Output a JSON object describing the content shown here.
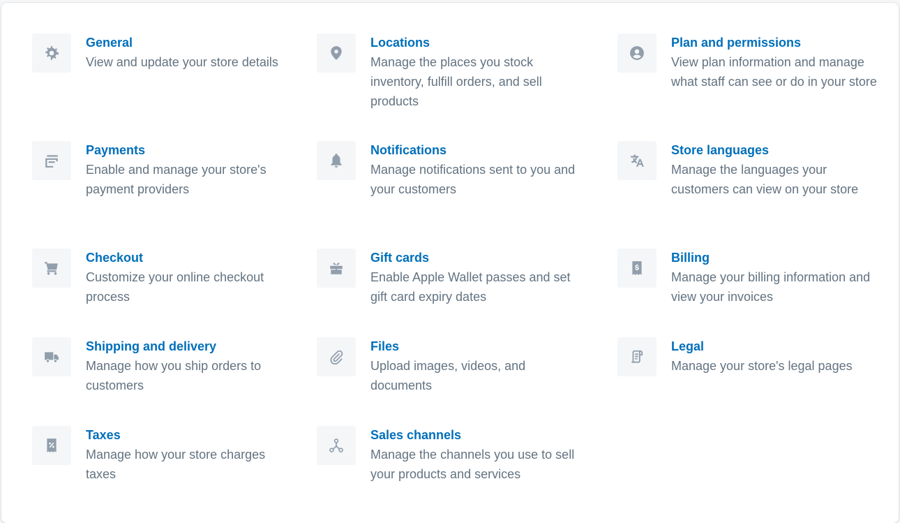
{
  "settings": {
    "items": [
      {
        "title": "General",
        "desc": "View and update your store details",
        "icon": "gear-icon"
      },
      {
        "title": "Locations",
        "desc": "Manage the places you stock inventory, fulfill orders, and sell products",
        "icon": "location-pin-icon"
      },
      {
        "title": "Plan and permissions",
        "desc": "View plan information and manage what staff can see or do in your store",
        "icon": "user-circle-icon"
      },
      {
        "title": "Payments",
        "desc": "Enable and manage your store's payment providers",
        "icon": "credit-card-icon"
      },
      {
        "title": "Notifications",
        "desc": "Manage notifications sent to you and your customers",
        "icon": "bell-icon"
      },
      {
        "title": "Store languages",
        "desc": "Manage the languages your customers can view on your store",
        "icon": "translate-icon"
      },
      {
        "title": "Checkout",
        "desc": "Customize your online checkout process",
        "icon": "cart-icon"
      },
      {
        "title": "Gift cards",
        "desc": "Enable Apple Wallet passes and set gift card expiry dates",
        "icon": "gift-icon"
      },
      {
        "title": "Billing",
        "desc": "Manage your billing information and view your invoices",
        "icon": "billing-receipt-icon"
      },
      {
        "title": "Shipping and delivery",
        "desc": "Manage how you ship orders to customers",
        "icon": "truck-icon"
      },
      {
        "title": "Files",
        "desc": "Upload images, videos, and documents",
        "icon": "paperclip-icon"
      },
      {
        "title": "Legal",
        "desc": "Manage your store's legal pages",
        "icon": "legal-document-icon"
      },
      {
        "title": "Taxes",
        "desc": "Manage how your store charges taxes",
        "icon": "tax-receipt-icon"
      },
      {
        "title": "Sales channels",
        "desc": "Manage the channels you use to sell your products and services",
        "icon": "sales-channels-icon"
      }
    ]
  },
  "colors": {
    "title": "#006fbb",
    "description": "#637381",
    "icon": "#919eab",
    "icon_background": "#f4f6f8"
  }
}
